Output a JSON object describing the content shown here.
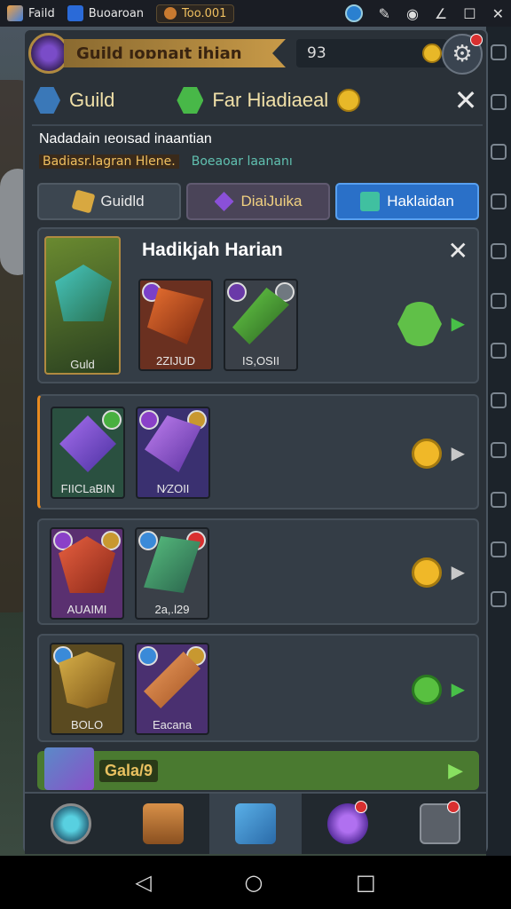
{
  "statusbar": {
    "app1": "Faild",
    "app2": "Buoaroan",
    "coin": "Too.001"
  },
  "title_bar": {
    "ribbon": "Guild  ıoɒnaıt ihian",
    "count": "93"
  },
  "header": {
    "left_label": "Guild",
    "mid_label": "Far Hiadiaeal"
  },
  "description": {
    "line1": "Nadadain ıeoısad inaantian",
    "tag_a": "Badiasr.lagran Hlene.",
    "tag_b": "Boeaoar laananı"
  },
  "tabs": [
    {
      "label": "Guidld"
    },
    {
      "label": "DiaiJuika"
    },
    {
      "label": "Haklaidan"
    }
  ],
  "card_main": {
    "title": "Hadikjah Harian",
    "items": [
      "Guld",
      "2ZIJUD",
      "IS,OSII"
    ]
  },
  "card_2": {
    "items": [
      "FIICLaBIN",
      "N⁄ZOII"
    ]
  },
  "card_3": {
    "items": [
      "AUAIMI",
      "2a,.l29"
    ]
  },
  "card_4": {
    "items": [
      "BOLO",
      "Eacana"
    ]
  },
  "bottom_strip": {
    "label": "Gala/9"
  },
  "colors": {
    "panel": "#2a3138",
    "accent_tab": "#2a70c8",
    "gold": "#e8b828",
    "green": "#58c040"
  }
}
